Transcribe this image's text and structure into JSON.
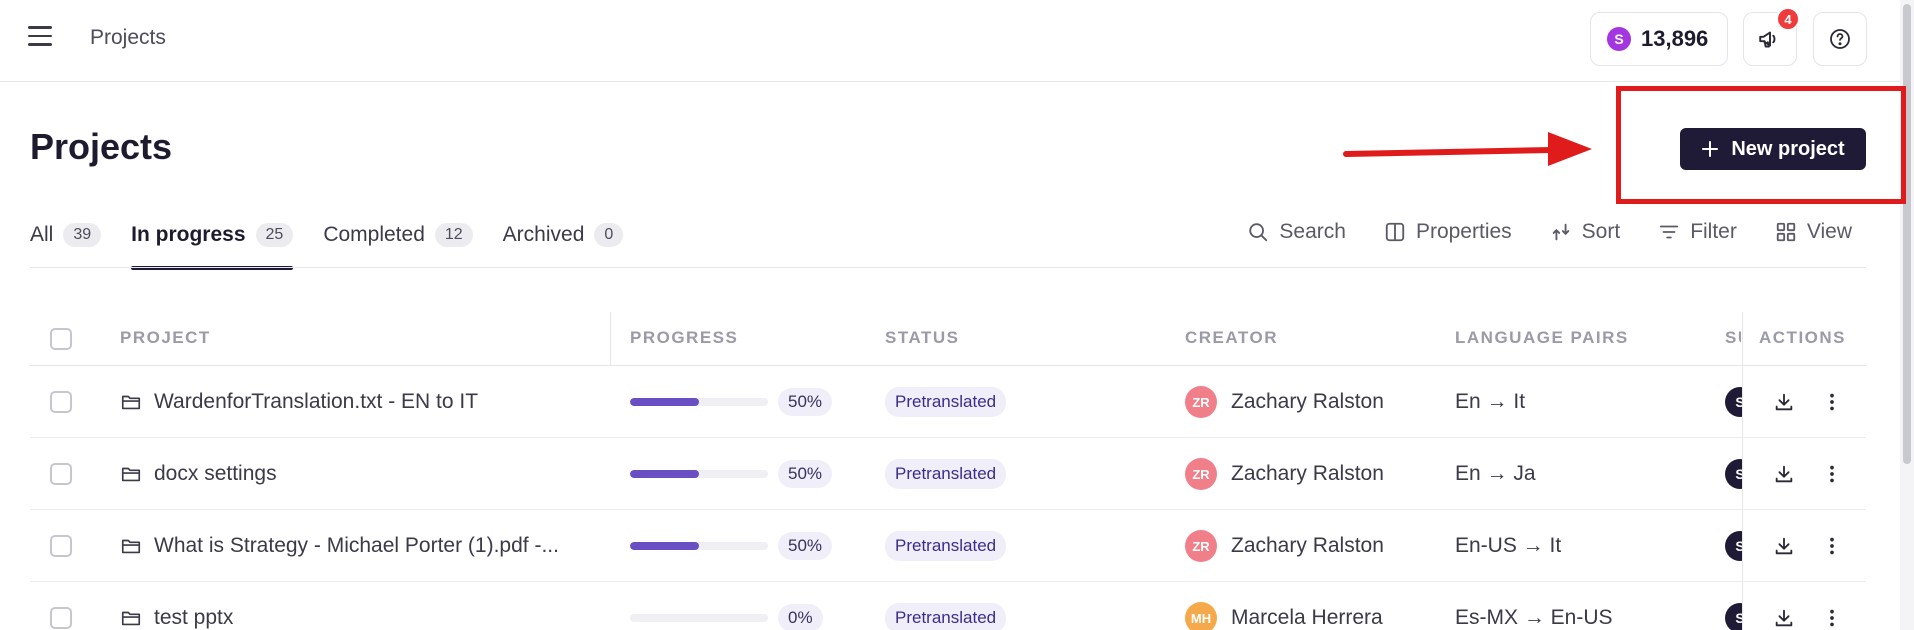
{
  "header": {
    "breadcrumb": "Projects",
    "credits": "13,896",
    "credits_coin_letter": "S",
    "notifications_count": "4"
  },
  "page": {
    "title": "Projects",
    "new_project_label": "New project"
  },
  "tabs": [
    {
      "label": "All",
      "count": "39"
    },
    {
      "label": "In progress",
      "count": "25"
    },
    {
      "label": "Completed",
      "count": "12"
    },
    {
      "label": "Archived",
      "count": "0"
    }
  ],
  "toolbar": {
    "search": "Search",
    "properties": "Properties",
    "sort": "Sort",
    "filter": "Filter",
    "view": "View"
  },
  "table": {
    "columns": {
      "project": "PROJECT",
      "progress": "PROGRESS",
      "status": "STATUS",
      "creator": "CREATOR",
      "language_pairs": "LANGUAGE PAIRS",
      "s_col": "SU",
      "actions": "ACTIONS"
    },
    "rows": [
      {
        "name": "WardenforTranslation.txt - EN to IT",
        "progress_label": "50%",
        "progress": 0.5,
        "status": "Pretranslated",
        "creator_initials": "ZR",
        "creator": "Zachary Ralston",
        "creator_color": "#f07f8a",
        "languages": "En → It",
        "s_badge": "S"
      },
      {
        "name": "docx settings",
        "progress_label": "50%",
        "progress": 0.5,
        "status": "Pretranslated",
        "creator_initials": "ZR",
        "creator": "Zachary Ralston",
        "creator_color": "#f07f8a",
        "languages": "En → Ja",
        "s_badge": "S"
      },
      {
        "name": "What is Strategy - Michael Porter (1).pdf -...",
        "progress_label": "50%",
        "progress": 0.5,
        "status": "Pretranslated",
        "creator_initials": "ZR",
        "creator": "Zachary Ralston",
        "creator_color": "#f07f8a",
        "languages": "En-US → It",
        "s_badge": "S"
      },
      {
        "name": "test pptx",
        "progress_label": "0%",
        "progress": 0,
        "status": "Pretranslated",
        "creator_initials": "MH",
        "creator": "Marcela Herrera",
        "creator_color": "#f5a94a",
        "languages": "Es-MX → En-US",
        "s_badge": "S"
      }
    ]
  },
  "colors": {
    "accent": "#1f1b36",
    "progress_fill": "#6a4fc4",
    "highlight": "#e01b1b"
  }
}
